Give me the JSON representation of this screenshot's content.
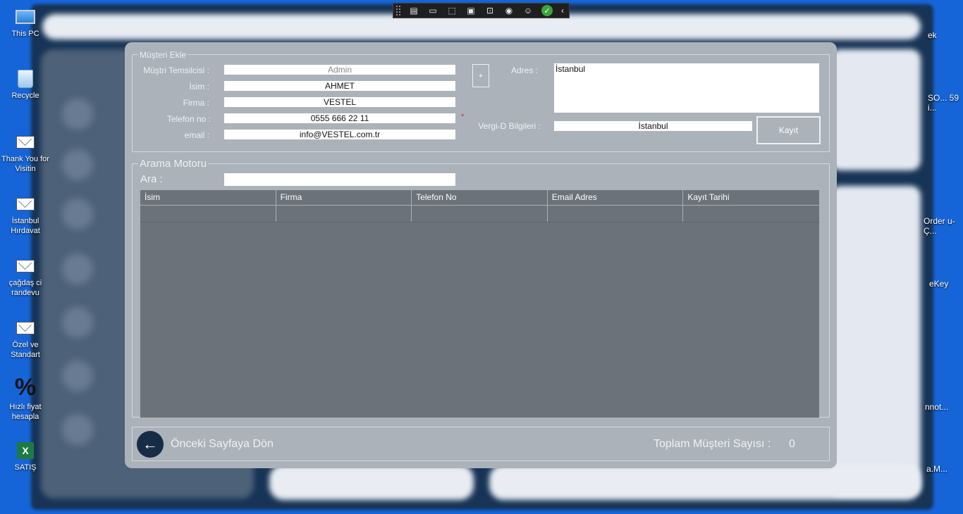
{
  "desktop_icons": [
    {
      "label": "This PC",
      "icon": "this-pc-icon"
    },
    {
      "label": "Recycle",
      "icon": "recycle-bin-icon"
    },
    {
      "label": "Thank You for Visitin",
      "icon": "envelope-icon"
    },
    {
      "label": "İstanbul Hırdavat",
      "icon": "envelope-icon"
    },
    {
      "label": "çağdaş ci randevu",
      "icon": "envelope-icon"
    },
    {
      "label": "Özel ve Standart",
      "icon": "envelope-icon"
    },
    {
      "label": "Hızlı fiyat hesapla",
      "icon": "percent-shortcut-icon"
    },
    {
      "label": "SATIŞ",
      "icon": "excel-icon"
    }
  ],
  "desktop_right_labels": [
    "ek",
    "SO... 59 i...",
    "Order u-Ç...",
    "eKey",
    "nnot...",
    "a.M..."
  ],
  "toolbar": {
    "icons": [
      "new-window-icon",
      "camera-icon",
      "select-pointer-icon",
      "frame-icon",
      "element-pick-icon",
      "broadcast-icon",
      "accessibility-icon"
    ],
    "check_icon": "check-circle-icon",
    "collapse_icon": "chevron-left-icon"
  },
  "customer_form": {
    "legend": "Müşteri Ekle",
    "representative_label": "Müştri Temsilcisi :",
    "representative_value": "Admin",
    "name_label": "İsim :",
    "name_value": "AHMET",
    "company_label": "Firma :",
    "company_value": "VESTEL",
    "phone_label": "Telefon no :",
    "phone_value": "0555 666 22 11",
    "required_mark": "*",
    "email_label": "email :",
    "email_value": "info@VESTEL.com.tr",
    "plus_label": "+",
    "address_label": "Adres :",
    "address_value": "İstanbul",
    "tax_label": "Vergi-D Bilgileri :",
    "tax_value": "İstanbul",
    "save_label": "Kayıt"
  },
  "search": {
    "legend": "Arama Motoru",
    "label": "Ara :",
    "value": ""
  },
  "table": {
    "columns": [
      "İsim",
      "Firma",
      "Telefon No",
      "Email Adres",
      "Kayıt Tarihi"
    ],
    "rows": []
  },
  "footer": {
    "back_icon": "arrow-left-icon",
    "back_label": "Önceki Sayfaya Dön",
    "total_label": "Toplam Müşteri Sayısı :",
    "total_value": "0"
  }
}
